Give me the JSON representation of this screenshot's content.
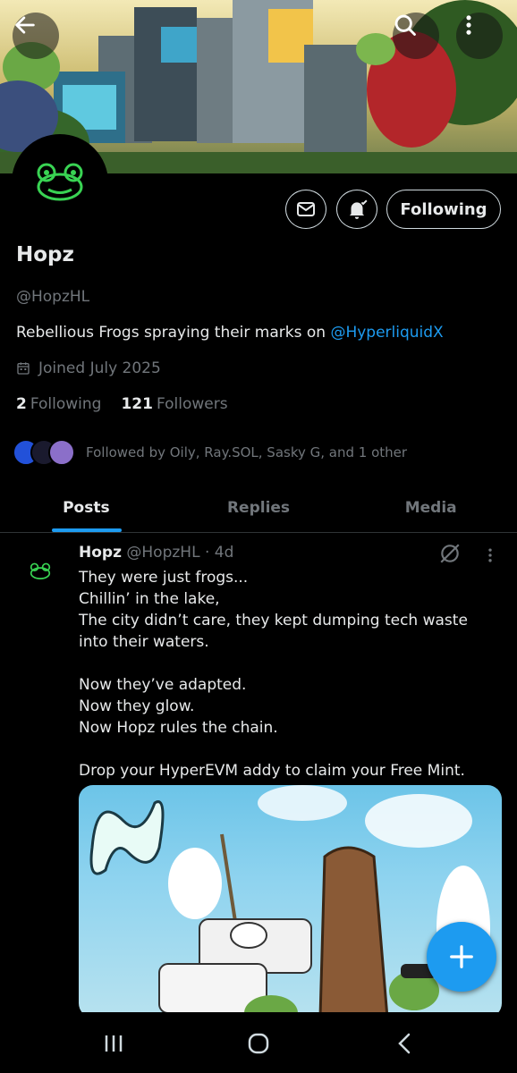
{
  "profile": {
    "name": "Hopz",
    "handle": "@HopzHL",
    "bio_text": "Rebellious Frogs spraying their marks on ",
    "bio_mention": "@HyperliquidX",
    "joined": "Joined July 2025",
    "following_count": "2",
    "following_label": "Following",
    "followers_count": "121",
    "followers_label": "Followers",
    "followed_by": "Followed by Oily, Ray.SOL, Sasky G, and 1 other",
    "follow_button": "Following"
  },
  "tabs": [
    {
      "label": "Posts",
      "active": true
    },
    {
      "label": "Replies",
      "active": false
    },
    {
      "label": "Media",
      "active": false
    }
  ],
  "post": {
    "author": "Hopz",
    "handle": "@HopzHL",
    "time": "· 4d",
    "lines": [
      "They were just frogs...",
      "Chillin’ in the lake,",
      "The city didn’t care, they kept dumping tech waste into their waters.",
      "",
      "Now they’ve adapted.",
      "Now they glow.",
      "Now Hopz rules the chain.",
      "",
      "Drop your HyperEVM addy to claim your Free Mint."
    ]
  },
  "icons": {
    "back": "back-arrow-icon",
    "search": "search-icon",
    "more": "more-vertical-icon",
    "message": "envelope-icon",
    "notify": "bell-icon",
    "calendar": "calendar-icon",
    "grok": "grok-icon",
    "compose": "plus-icon"
  },
  "colors": {
    "accent": "#1d9bf0",
    "background": "#000000",
    "text_primary": "#e7e9ea",
    "text_secondary": "#71767b",
    "frog_green": "#39d353"
  }
}
